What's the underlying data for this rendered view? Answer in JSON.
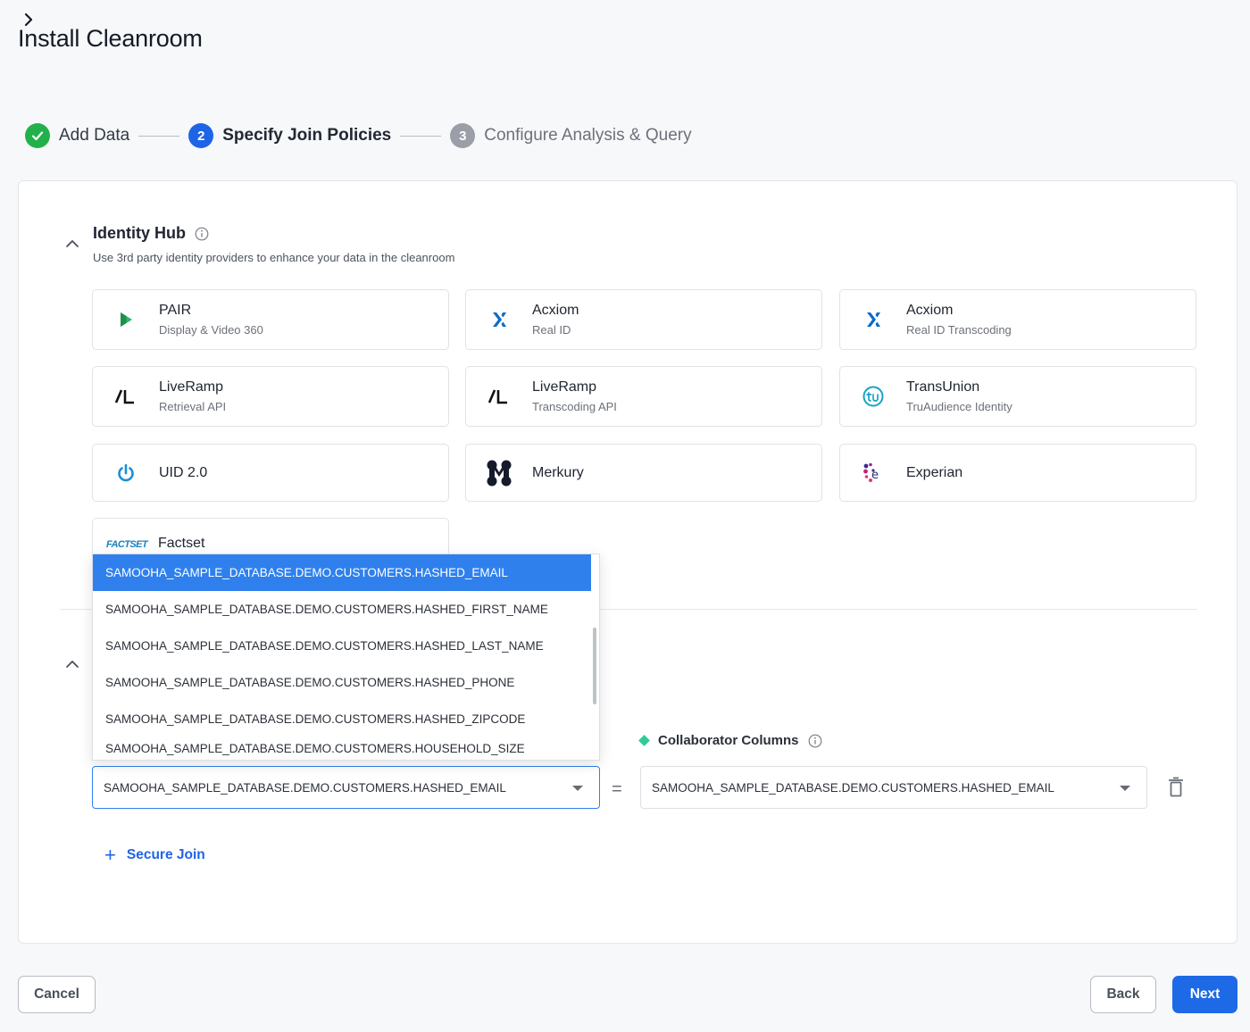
{
  "page": {
    "title": "Install Cleanroom"
  },
  "stepper": {
    "steps": [
      {
        "number": "",
        "label": "Add Data"
      },
      {
        "number": "2",
        "label": "Specify Join Policies"
      },
      {
        "number": "3",
        "label": "Configure Analysis & Query"
      }
    ]
  },
  "identity_hub": {
    "title": "Identity Hub",
    "subtitle": "Use 3rd party identity providers to enhance your data in the cleanroom",
    "tiles": [
      {
        "name": "PAIR",
        "desc": "Display & Video 360",
        "icon": "pair-play-icon"
      },
      {
        "name": "Acxiom",
        "desc": "Real ID",
        "icon": "acxiom-icon"
      },
      {
        "name": "Acxiom",
        "desc": "Real ID Transcoding",
        "icon": "acxiom-icon"
      },
      {
        "name": "LiveRamp",
        "desc": "Retrieval API",
        "icon": "liveramp-icon"
      },
      {
        "name": "LiveRamp",
        "desc": "Transcoding API",
        "icon": "liveramp-icon"
      },
      {
        "name": "TransUnion",
        "desc": "TruAudience Identity",
        "icon": "transunion-icon"
      },
      {
        "name": "UID 2.0",
        "desc": "",
        "icon": "uid-power-icon"
      },
      {
        "name": "Merkury",
        "desc": "",
        "icon": "merkury-icon"
      },
      {
        "name": "Experian",
        "desc": "",
        "icon": "experian-icon"
      },
      {
        "name": "Factset",
        "desc": "",
        "icon": "factset-icon",
        "logo_text": "FACTSET"
      }
    ]
  },
  "dropdown": {
    "options": [
      "SAMOOHA_SAMPLE_DATABASE.DEMO.CUSTOMERS.HASHED_EMAIL",
      "SAMOOHA_SAMPLE_DATABASE.DEMO.CUSTOMERS.HASHED_FIRST_NAME",
      "SAMOOHA_SAMPLE_DATABASE.DEMO.CUSTOMERS.HASHED_LAST_NAME",
      "SAMOOHA_SAMPLE_DATABASE.DEMO.CUSTOMERS.HASHED_PHONE",
      "SAMOOHA_SAMPLE_DATABASE.DEMO.CUSTOMERS.HASHED_ZIPCODE",
      "SAMOOHA_SAMPLE_DATABASE.DEMO.CUSTOMERS.HOUSEHOLD_SIZE"
    ]
  },
  "join": {
    "collaborator_label": "Collaborator Columns",
    "my_column_value": "SAMOOHA_SAMPLE_DATABASE.DEMO.CUSTOMERS.HASHED_EMAIL",
    "equals": "=",
    "collaborator_column_value": "SAMOOHA_SAMPLE_DATABASE.DEMO.CUSTOMERS.HASHED_EMAIL",
    "add_label": "Secure Join",
    "add_icon": "+"
  },
  "footer": {
    "cancel": "Cancel",
    "back": "Back",
    "next": "Next"
  },
  "colors": {
    "primary": "#1e64e6",
    "success": "#22b04b",
    "selected": "#2f80ed",
    "collaborator_accent": "#2ecc9a"
  }
}
